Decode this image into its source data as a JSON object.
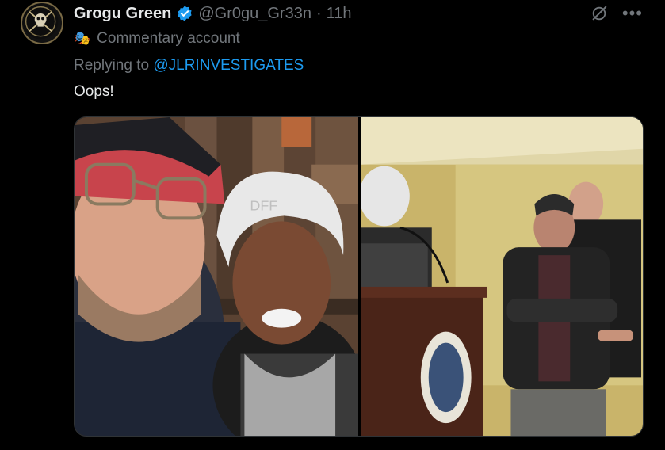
{
  "tweet": {
    "display_name": "Grogu Green",
    "handle": "@Gr0gu_Gr33n",
    "separator": "·",
    "time": "11h",
    "account_label": "Commentary account",
    "replying_prefix": "Replying to",
    "replying_to": "@JLRINVESTIGATES",
    "text": "Oops!"
  },
  "watermark": "DFF",
  "colors": {
    "background": "#000000",
    "text_primary": "#e7e9ea",
    "text_secondary": "#71767b",
    "accent": "#1d9bf0",
    "verified": "#1d9bf0"
  },
  "icons": {
    "verified": "verified-badge-icon",
    "grok": "grok-icon",
    "more": "more-icon",
    "account_label": "theater-mask-icon"
  }
}
